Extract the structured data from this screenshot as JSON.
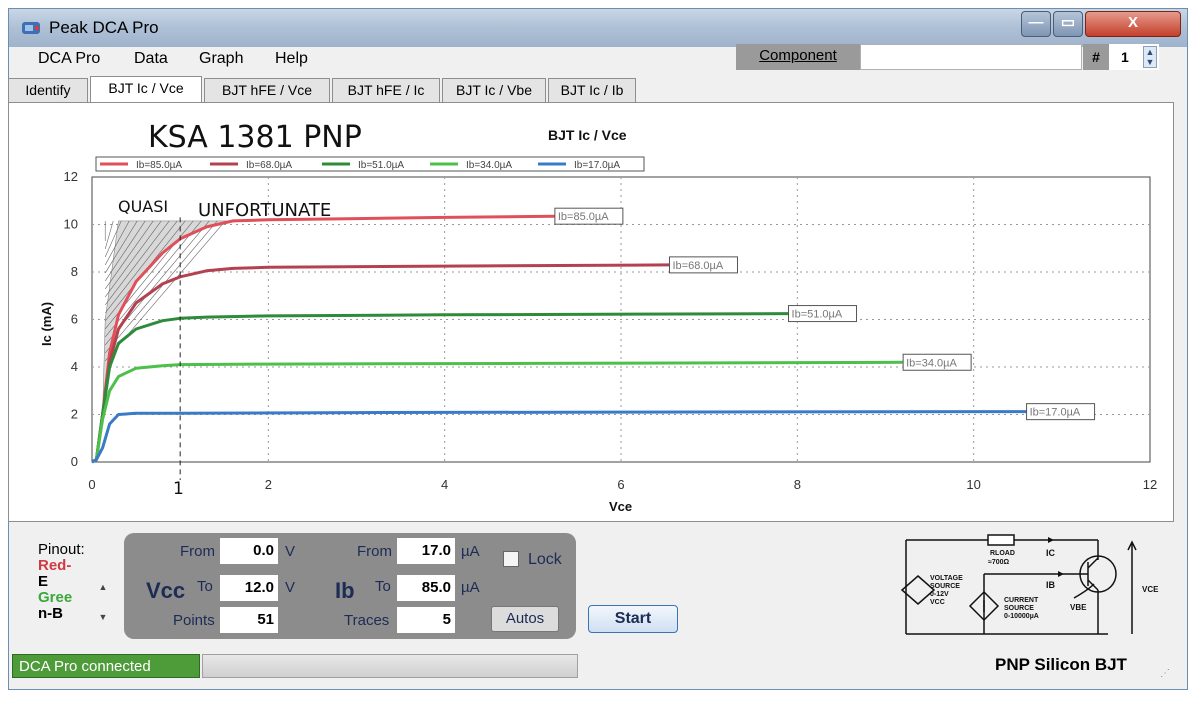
{
  "window": {
    "title": "Peak DCA Pro",
    "minimize": "—",
    "maximize": "▭",
    "close": "X"
  },
  "menu": [
    "DCA Pro",
    "Data",
    "Graph",
    "Help"
  ],
  "component": {
    "button": "Component",
    "value": "",
    "hash_label": "#",
    "number": "1"
  },
  "tabs": [
    "Identify",
    "BJT Ic / Vce",
    "BJT hFE / Vce",
    "BJT hFE / Ic",
    "BJT Ic / Vbe",
    "BJT Ic / Ib"
  ],
  "active_tab": 1,
  "annotations": {
    "part": "KSA 1381   PNP",
    "quasi": "QUASI",
    "unfortunate": "UNFORTUNATE",
    "mark": "1"
  },
  "chart_data": {
    "type": "line",
    "title": "BJT Ic / Vce",
    "xlabel": "Vce",
    "ylabel": "Ic (mA)",
    "xlim": [
      0,
      12
    ],
    "ylim": [
      0,
      12
    ],
    "xticks": [
      "0",
      "2",
      "4",
      "6",
      "8",
      "10",
      "12"
    ],
    "yticks": [
      "0",
      "2",
      "4",
      "6",
      "8",
      "10",
      "12"
    ],
    "grid": true,
    "legend_position": "top",
    "series": [
      {
        "name": "Ib=85.0µA",
        "color": "#e0505a",
        "label_at_x": 5.25,
        "points": [
          [
            0,
            0
          ],
          [
            0.05,
            0.1
          ],
          [
            0.12,
            2.0
          ],
          [
            0.2,
            4.6
          ],
          [
            0.3,
            6.2
          ],
          [
            0.5,
            7.6
          ],
          [
            0.8,
            8.8
          ],
          [
            1.0,
            9.4
          ],
          [
            1.3,
            9.9
          ],
          [
            1.6,
            10.15
          ],
          [
            2.0,
            10.2
          ],
          [
            3.0,
            10.25
          ],
          [
            4.0,
            10.3
          ],
          [
            5.25,
            10.35
          ]
        ]
      },
      {
        "name": "Ib=68.0µA",
        "color": "#b44150",
        "label_at_x": 6.55,
        "points": [
          [
            0,
            0
          ],
          [
            0.05,
            0.1
          ],
          [
            0.12,
            2.0
          ],
          [
            0.2,
            4.2
          ],
          [
            0.3,
            5.6
          ],
          [
            0.5,
            6.7
          ],
          [
            0.8,
            7.5
          ],
          [
            1.0,
            7.8
          ],
          [
            1.3,
            8.05
          ],
          [
            1.6,
            8.15
          ],
          [
            2.0,
            8.2
          ],
          [
            4.0,
            8.25
          ],
          [
            6.55,
            8.3
          ]
        ]
      },
      {
        "name": "Ib=51.0µA",
        "color": "#2e8b3a",
        "label_at_x": 7.9,
        "points": [
          [
            0,
            0
          ],
          [
            0.05,
            0.1
          ],
          [
            0.12,
            2.0
          ],
          [
            0.2,
            4.0
          ],
          [
            0.3,
            5.0
          ],
          [
            0.5,
            5.6
          ],
          [
            0.8,
            5.95
          ],
          [
            1.0,
            6.05
          ],
          [
            1.3,
            6.1
          ],
          [
            2.0,
            6.15
          ],
          [
            4.0,
            6.2
          ],
          [
            7.9,
            6.25
          ]
        ]
      },
      {
        "name": "Ib=34.0µA",
        "color": "#4cc04a",
        "label_at_x": 9.2,
        "points": [
          [
            0,
            0
          ],
          [
            0.05,
            0.1
          ],
          [
            0.12,
            1.8
          ],
          [
            0.2,
            3.0
          ],
          [
            0.3,
            3.6
          ],
          [
            0.5,
            3.95
          ],
          [
            0.8,
            4.05
          ],
          [
            1.0,
            4.1
          ],
          [
            2.0,
            4.12
          ],
          [
            5.0,
            4.15
          ],
          [
            9.2,
            4.2
          ]
        ]
      },
      {
        "name": "Ib=17.0µA",
        "color": "#3a7ac8",
        "label_at_x": 10.6,
        "points": [
          [
            0,
            0
          ],
          [
            0.05,
            0.1
          ],
          [
            0.12,
            0.6
          ],
          [
            0.2,
            1.6
          ],
          [
            0.3,
            2.0
          ],
          [
            0.5,
            2.05
          ],
          [
            1.0,
            2.05
          ],
          [
            3.0,
            2.08
          ],
          [
            6.0,
            2.1
          ],
          [
            10.6,
            2.12
          ]
        ]
      }
    ]
  },
  "controls": {
    "vcc": {
      "label": "Vcc",
      "from_label": "From",
      "from": "0.0",
      "to_label": "To",
      "to": "12.0",
      "unit": "V",
      "points_label": "Points",
      "points": "51"
    },
    "ib": {
      "label": "Ib",
      "from_label": "From",
      "from": "17.0",
      "to_label": "To",
      "to": "85.0",
      "unit": "µA",
      "traces_label": "Traces",
      "traces": "5"
    },
    "lock": "Lock",
    "autos": "Autos",
    "start": "Start"
  },
  "pinout": {
    "label": "Pinout:",
    "items": [
      {
        "text": "Red-",
        "color": "#d03a44"
      },
      {
        "text": "E",
        "color": "#000000"
      },
      {
        "text": "Gree",
        "color": "#3aa83a"
      },
      {
        "text": "n-B",
        "color": "#000000"
      }
    ]
  },
  "circuit": {
    "rload": "RLOAD",
    "rload_val": "≈700Ω",
    "ic": "IC",
    "ib": "IB",
    "vsource": [
      "VOLTAGE",
      "SOURCE",
      "0-12V",
      "VCC"
    ],
    "isource": [
      "CURRENT",
      "SOURCE",
      "0-10000µA"
    ],
    "vbe": "VBE",
    "vce": "VCE"
  },
  "status": {
    "connection": "DCA Pro connected",
    "device": "PNP Silicon BJT"
  }
}
